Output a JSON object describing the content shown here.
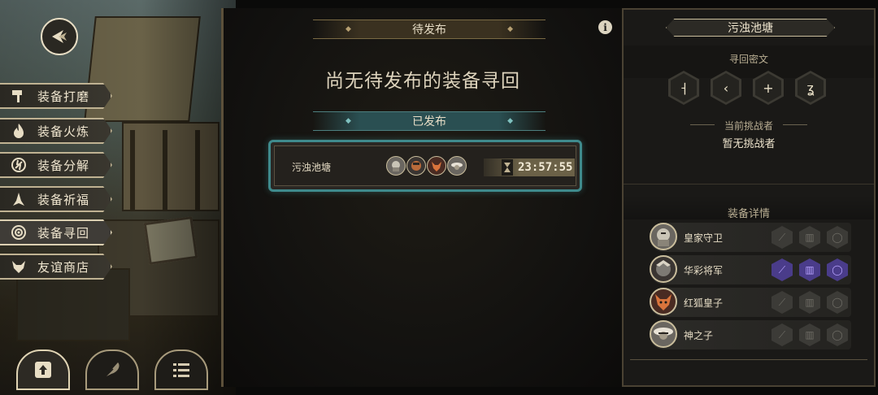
{
  "sidebar": {
    "items": [
      {
        "label": "装备打磨",
        "icon": "hammer-icon"
      },
      {
        "label": "装备火炼",
        "icon": "flame-icon"
      },
      {
        "label": "装备分解",
        "icon": "break-icon"
      },
      {
        "label": "装备祈福",
        "icon": "pray-icon"
      },
      {
        "label": "装备寻回",
        "icon": "target-icon"
      },
      {
        "label": "友谊商店",
        "icon": "fox-icon"
      }
    ]
  },
  "center": {
    "pending_header": "待发布",
    "pending_empty": "尚无待发布的装备寻回",
    "published_header": "已发布",
    "published": {
      "name": "污浊池塘",
      "timer": "23:57:55"
    }
  },
  "right": {
    "title": "污浊池塘",
    "cipher_label": "寻回密文",
    "challenger_label": "当前挑战者",
    "challenger_value": "暂无挑战者",
    "details_label": "装备详情",
    "equipment": [
      {
        "name": "皇家守卫",
        "slots_active": false
      },
      {
        "name": "华彩将军",
        "slots_active": true
      },
      {
        "name": "红狐皇子",
        "slots_active": false
      },
      {
        "name": "神之子",
        "slots_active": false
      }
    ]
  },
  "colors": {
    "accent": "#c9bd9c",
    "panel": "#1a1917",
    "active_slot": "#4a3c8a",
    "teal": "#2c5a5c"
  }
}
